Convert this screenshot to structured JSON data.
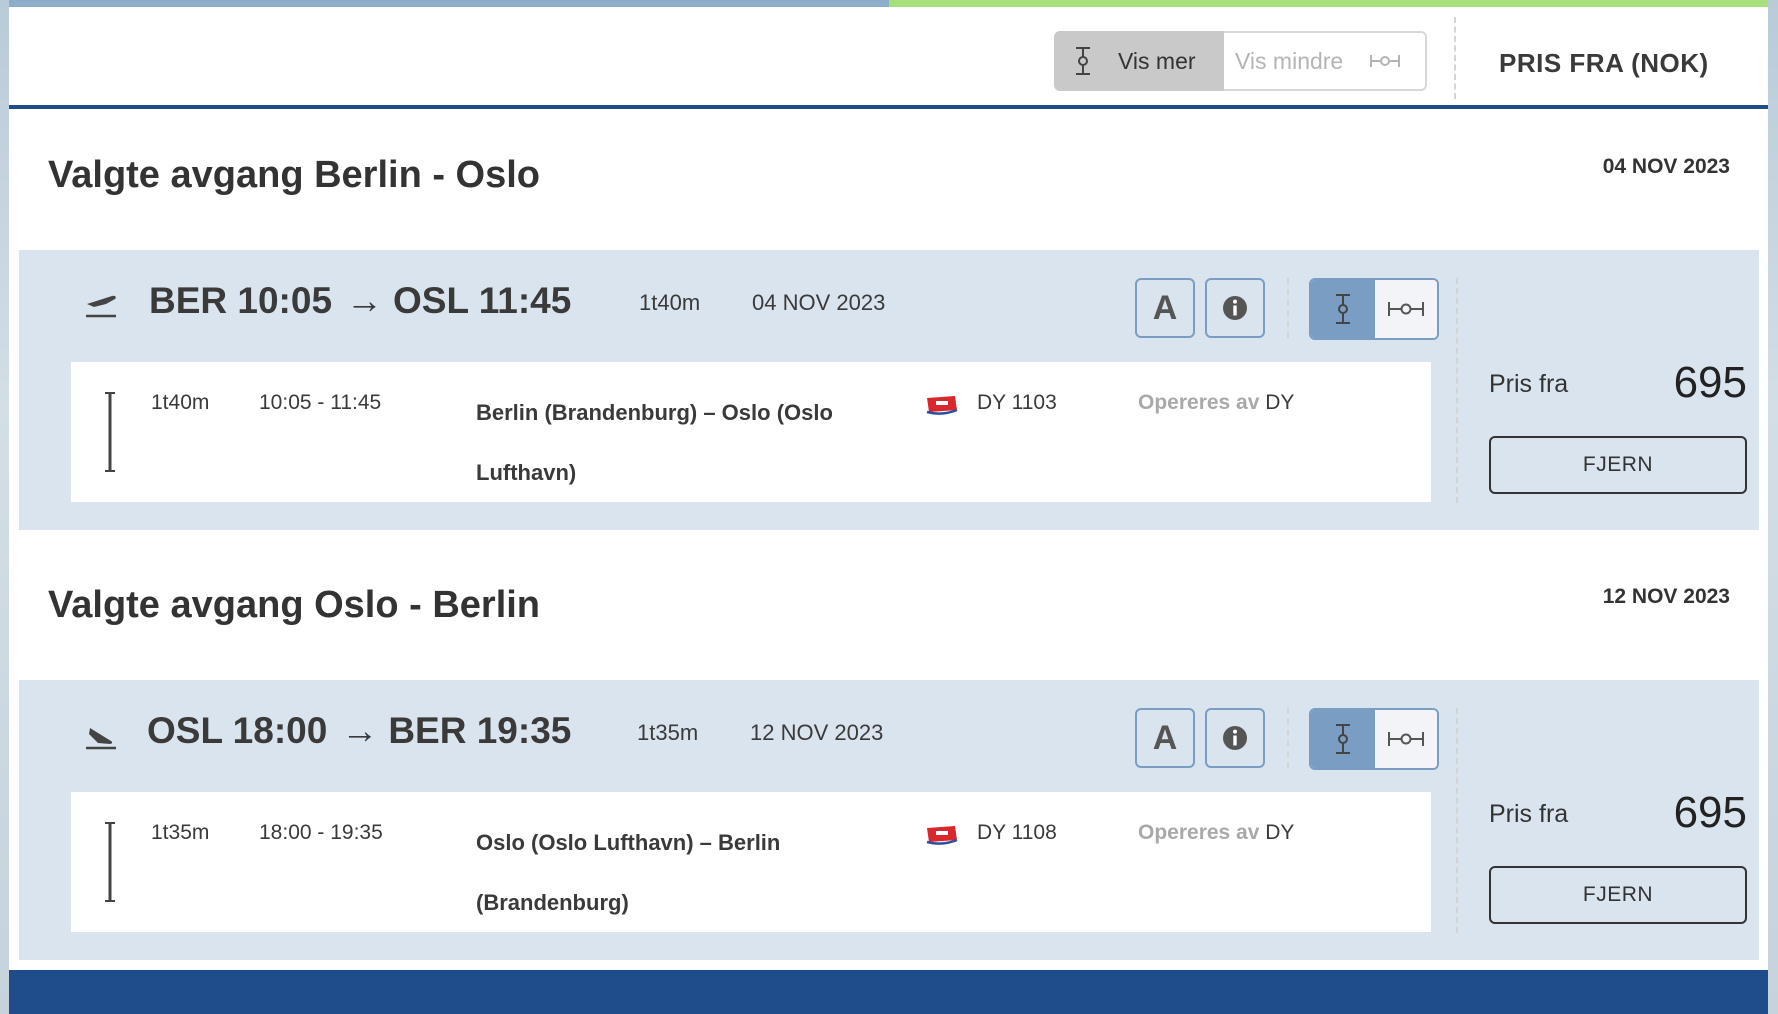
{
  "topbar": {
    "vis_mer_label": "Vis mer",
    "vis_mindre_label": "Vis mindre",
    "price_header": "PRIS FRA (NOK)"
  },
  "sections": [
    {
      "title": "Valgte avgang Berlin - Oslo",
      "date": "04 NOV 2023",
      "flight": {
        "direction_icon": "plane-departure-icon",
        "origin": "BER 10:05",
        "destination": "OSL 11:45",
        "duration": "1t40m",
        "date": "04 NOV 2023",
        "segment": {
          "duration": "1t40m",
          "time": "10:05 - 11:45",
          "route": "Berlin (Brandenburg) – Oslo (Oslo Lufthavn)",
          "flight_number": "DY 1103",
          "operated_label": "Opereres av",
          "operator": "DY"
        },
        "price_label": "Pris fra",
        "price": "695",
        "remove_label": "FJERN"
      }
    },
    {
      "title": "Valgte avgang Oslo - Berlin",
      "date": "12 NOV 2023",
      "flight": {
        "direction_icon": "plane-arrival-icon",
        "origin": "OSL 18:00",
        "destination": "BER 19:35",
        "duration": "1t35m",
        "date": "12 NOV 2023",
        "segment": {
          "duration": "1t35m",
          "time": "18:00 - 19:35",
          "route": "Oslo (Oslo Lufthavn) – Berlin (Brandenburg)",
          "flight_number": "DY 1108",
          "operated_label": "Opereres av",
          "operator": "DY"
        },
        "price_label": "Pris fra",
        "price": "695",
        "remove_label": "FJERN"
      }
    }
  ],
  "buttons": {
    "fare_rules_letter": "A"
  },
  "colors": {
    "accent_blue": "#1f4d8c",
    "card_bg": "#dae4ee",
    "toggle_active": "#7a9dc4",
    "progress_done": "#8eadc8",
    "progress_current": "#a7e07a"
  }
}
